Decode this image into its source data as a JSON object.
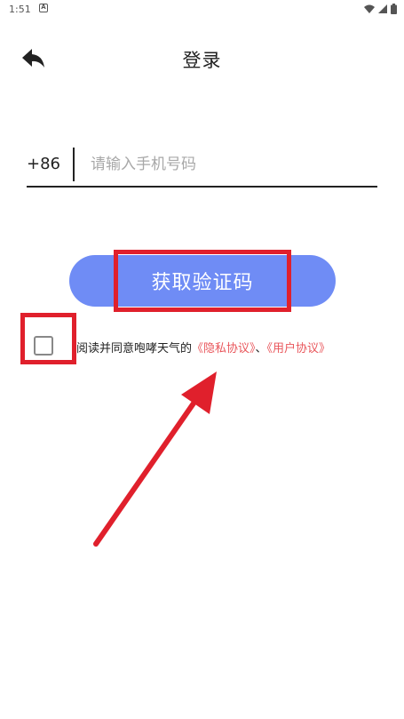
{
  "status_bar": {
    "time": "1:51",
    "notif_icon_letter": "A",
    "icons": [
      "wifi-icon",
      "signal-icon",
      "battery-icon"
    ]
  },
  "header": {
    "back_icon": "back-arrow-icon",
    "title": "登录"
  },
  "phone": {
    "country_code": "+86",
    "placeholder": "请输入手机号码",
    "value": ""
  },
  "get_code_button": {
    "label": "获取验证码",
    "color": "#6f8cf5"
  },
  "agreement": {
    "checked": false,
    "prefix": "阅读并同意咆哮天气的",
    "privacy_link": "《隐私协议》",
    "separator": "、",
    "user_link": "《用户协议》",
    "link_color": "#e9575c"
  },
  "annotations": {
    "highlight_color": "#e0202c"
  }
}
